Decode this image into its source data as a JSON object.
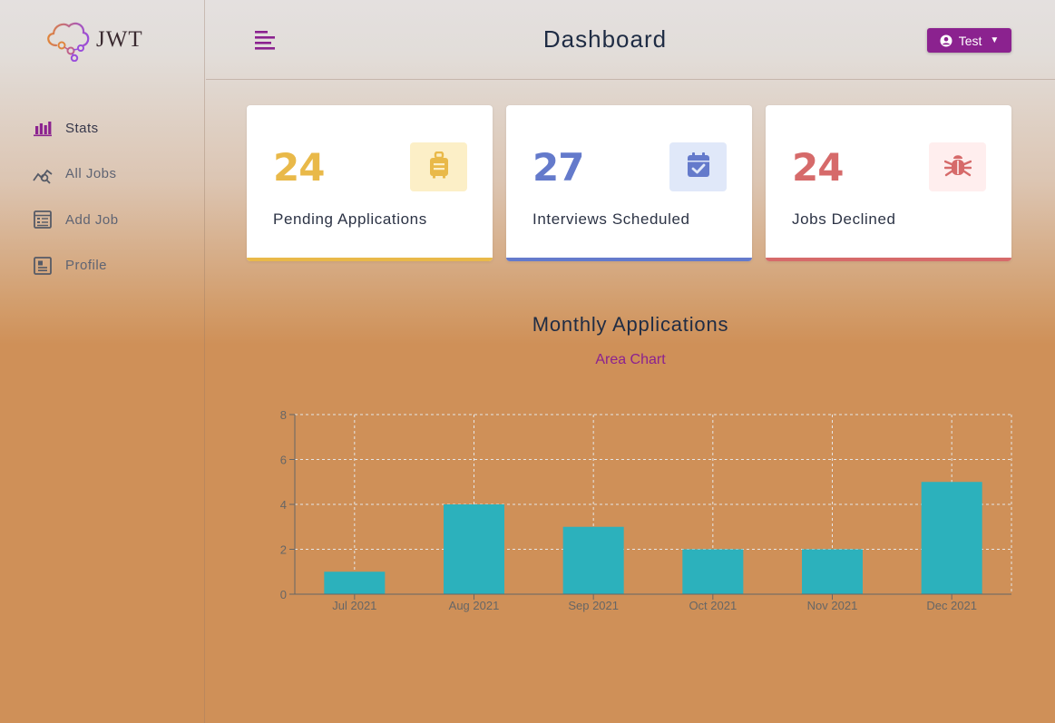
{
  "app": {
    "logo_text": "JWT"
  },
  "sidebar": {
    "items": [
      {
        "label": "Stats",
        "icon": "bar-chart-icon",
        "active": true
      },
      {
        "label": "All Jobs",
        "icon": "query-stats-icon",
        "active": false
      },
      {
        "label": "Add Job",
        "icon": "form-icon",
        "active": false
      },
      {
        "label": "Profile",
        "icon": "id-card-icon",
        "active": false
      }
    ]
  },
  "header": {
    "title": "Dashboard",
    "user_name": "Test",
    "menu_icon": "hamburger-icon"
  },
  "stats": [
    {
      "count": "24",
      "label": "Pending Applications",
      "color": "#e9b949",
      "bg": "#fcefc7",
      "icon": "suitcase-icon"
    },
    {
      "count": "27",
      "label": "Interviews Scheduled",
      "color": "#647acb",
      "bg": "#e0e8f9",
      "icon": "calendar-check-icon"
    },
    {
      "count": "24",
      "label": "Jobs Declined",
      "color": "#d66a6a",
      "bg": "#ffeeee",
      "icon": "bug-icon"
    }
  ],
  "chart": {
    "title": "Monthly Applications",
    "toggle_label": "Area Chart"
  },
  "chart_data": {
    "type": "bar",
    "categories": [
      "Jul 2021",
      "Aug 2021",
      "Sep 2021",
      "Oct 2021",
      "Nov 2021",
      "Dec 2021"
    ],
    "values": [
      1,
      4,
      3,
      2,
      2,
      5
    ],
    "title": "Monthly Applications",
    "xlabel": "",
    "ylabel": "",
    "ylim": [
      0,
      8
    ],
    "yticks": [
      0,
      2,
      4,
      6,
      8
    ],
    "grid": true,
    "bar_color": "#2cb1bc"
  }
}
